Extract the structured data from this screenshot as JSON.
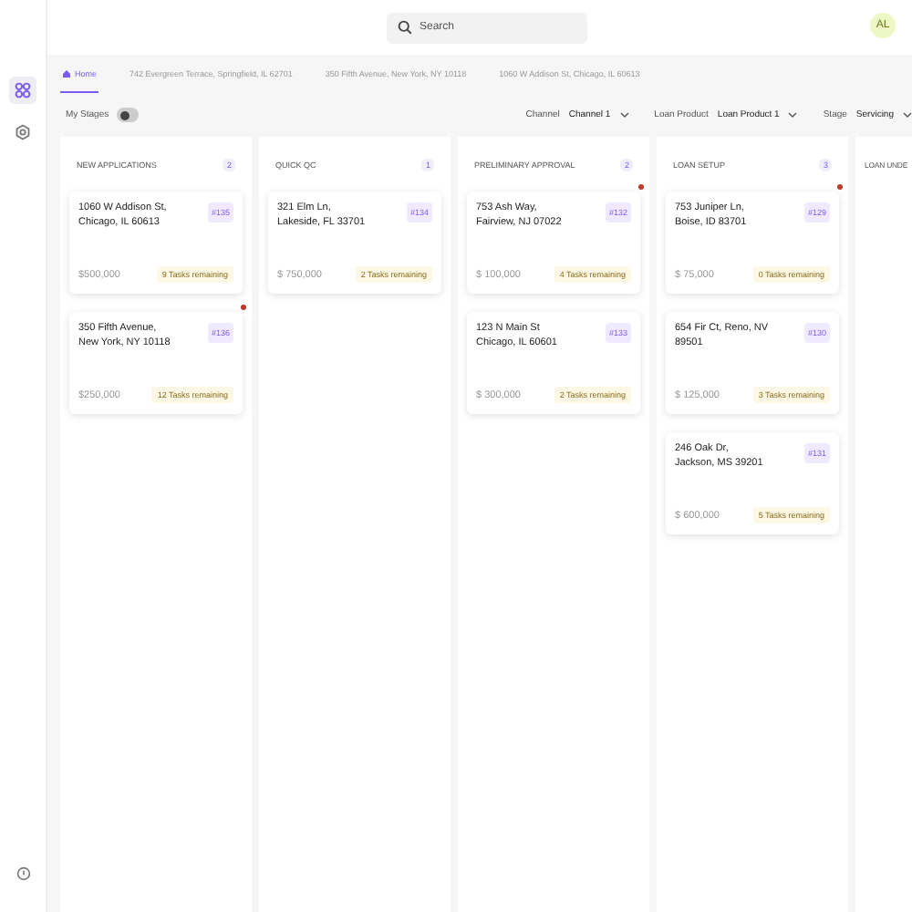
{
  "search": {
    "placeholder": "Search"
  },
  "user": {
    "initials": "AL"
  },
  "tabs": [
    {
      "label": "Home",
      "kind": "home",
      "selected": true
    },
    {
      "label": "742 Evergreen Terrace, Springfield, IL 62701",
      "kind": "loan",
      "selected": false
    },
    {
      "label": "350 Fifth Avenue, New York, NY 10118",
      "kind": "loan",
      "selected": false
    },
    {
      "label": "1060 W Addison St, Chicago, IL 60613",
      "kind": "loan",
      "selected": false
    }
  ],
  "my_stages": {
    "label": "My Stages",
    "on": false
  },
  "filters": [
    {
      "label": "Channel",
      "value": "Channel 1"
    },
    {
      "label": "Loan Product",
      "value": "Loan Product 1"
    },
    {
      "label": "Stage",
      "value": "Servicing"
    }
  ],
  "columns": [
    {
      "title": "NEW APPLICATIONS",
      "count": "2",
      "cards": [
        {
          "address": "1060 W Addison St, Chicago, IL 60613",
          "id": "#135",
          "amount": "$500,000",
          "tasks": "9 Tasks remaining",
          "flagged": false
        },
        {
          "address": "350 Fifth Avenue, New York, NY 10118",
          "id": "#136",
          "amount": "$250,000",
          "tasks": "12 Tasks remaining",
          "flagged": true
        }
      ]
    },
    {
      "title": "QUICK QC",
      "count": "1",
      "cards": [
        {
          "address": "321 Elm Ln, Lakeside, FL 33701",
          "id": "#134",
          "amount": "$ 750,000",
          "tasks": "2 Tasks remaining",
          "flagged": false
        }
      ]
    },
    {
      "title": "PRELIMINARY APPROVAL",
      "count": "2",
      "cards": [
        {
          "address": "753 Ash Way, Fairview, NJ 07022",
          "id": "#132",
          "amount": "$ 100,000",
          "tasks": "4 Tasks remaining",
          "flagged": true
        },
        {
          "address": "123 N Main St Chicago, IL 60601",
          "id": "#133",
          "amount": "$ 300,000",
          "tasks": "2 Tasks remaining",
          "flagged": false
        }
      ]
    },
    {
      "title": "LOAN SETUP",
      "count": "3",
      "cards": [
        {
          "address": "753 Juniper Ln, Boise, ID 83701",
          "id": "#129",
          "amount": "$ 75,000",
          "tasks": "0 Tasks remaining",
          "flagged": true
        },
        {
          "address": "654 Fir Ct, Reno, NV 89501",
          "id": "#130",
          "amount": "$ 125,000",
          "tasks": "3 Tasks remaining",
          "flagged": false
        },
        {
          "address": "246 Oak Dr, Jackson, MS 39201",
          "id": "#131",
          "amount": "$ 600,000",
          "tasks": "5 Tasks remaining",
          "flagged": false
        }
      ]
    },
    {
      "title": "LOAN UNDE"
    }
  ]
}
